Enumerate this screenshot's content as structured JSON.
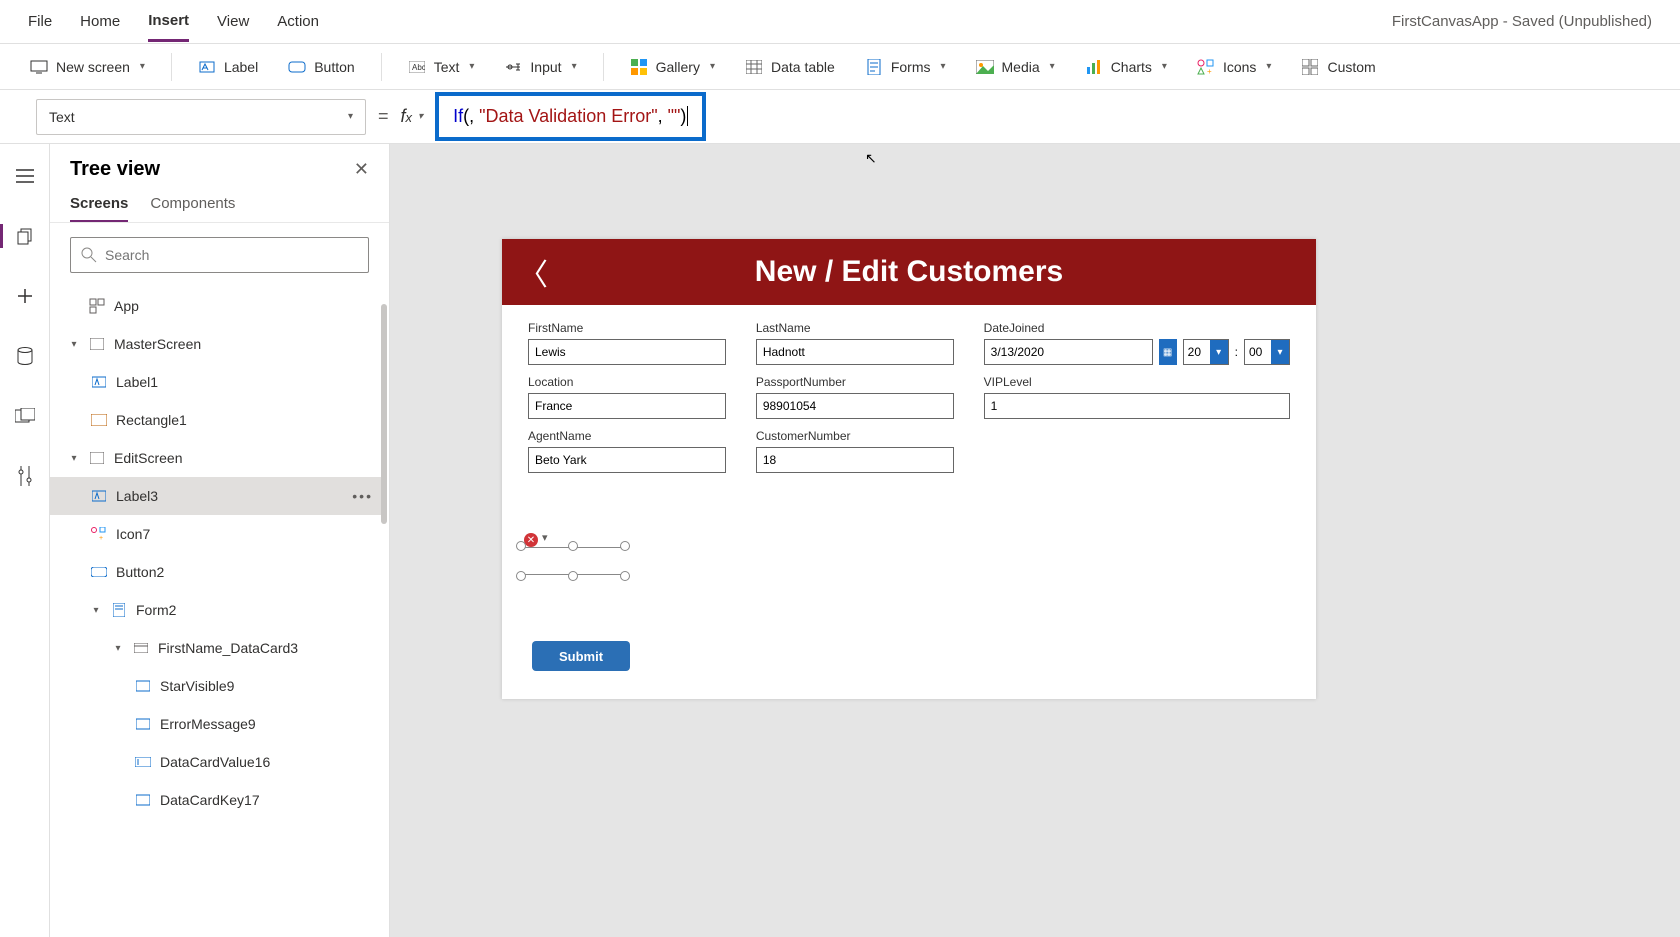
{
  "app_status": "FirstCanvasApp - Saved (Unpublished)",
  "menubar": {
    "file": "File",
    "home": "Home",
    "insert": "Insert",
    "view": "View",
    "action": "Action"
  },
  "ribbon": {
    "new_screen": "New screen",
    "label": "Label",
    "button": "Button",
    "text": "Text",
    "input": "Input",
    "gallery": "Gallery",
    "data_table": "Data table",
    "forms": "Forms",
    "media": "Media",
    "charts": "Charts",
    "icons": "Icons",
    "custom": "Custom"
  },
  "formula": {
    "property": "Text",
    "funcname": "If",
    "str1": "\"Data Validation Error\"",
    "str2": "\"\""
  },
  "tree": {
    "title": "Tree view",
    "tab_screens": "Screens",
    "tab_components": "Components",
    "search_placeholder": "Search",
    "items": {
      "app": "App",
      "master": "MasterScreen",
      "label1": "Label1",
      "rect1": "Rectangle1",
      "edit": "EditScreen",
      "label3": "Label3",
      "icon7": "Icon7",
      "button2": "Button2",
      "form2": "Form2",
      "dc": "FirstName_DataCard3",
      "star": "StarVisible9",
      "err": "ErrorMessage9",
      "dcv": "DataCardValue16",
      "dck": "DataCardKey17"
    }
  },
  "canvas": {
    "header_title": "New / Edit Customers",
    "fields": {
      "firstname_label": "FirstName",
      "firstname_value": "Lewis",
      "lastname_label": "LastName",
      "lastname_value": "Hadnott",
      "datejoined_label": "DateJoined",
      "datejoined_value": "3/13/2020",
      "hour": "20",
      "minute": "00",
      "location_label": "Location",
      "location_value": "France",
      "passport_label": "PassportNumber",
      "passport_value": "98901054",
      "vip_label": "VIPLevel",
      "vip_value": "1",
      "agent_label": "AgentName",
      "agent_value": "Beto Yark",
      "custnum_label": "CustomerNumber",
      "custnum_value": "18"
    },
    "submit": "Submit"
  }
}
